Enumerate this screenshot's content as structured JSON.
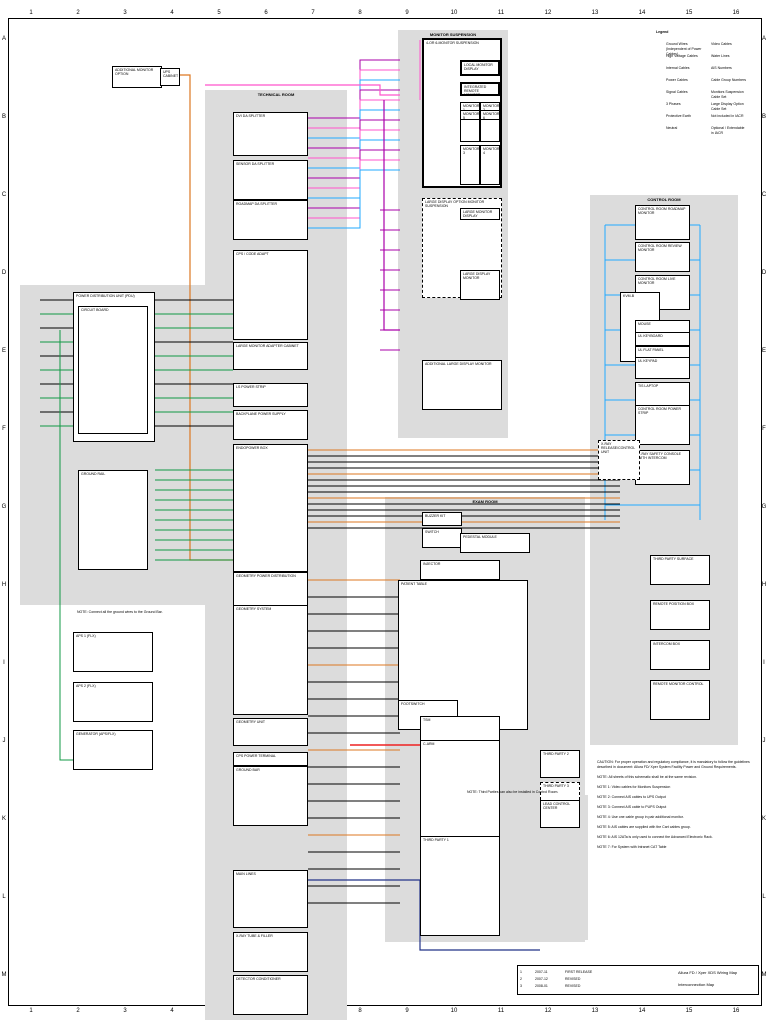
{
  "columns": [
    "1",
    "2",
    "3",
    "4",
    "5",
    "6",
    "7",
    "8",
    "9",
    "10",
    "11",
    "12",
    "13",
    "14",
    "15",
    "16"
  ],
  "rows": [
    "A",
    "B",
    "C",
    "D",
    "E",
    "F",
    "G",
    "H",
    "I",
    "J",
    "K",
    "L",
    "M"
  ],
  "rooms": [
    {
      "id": "monitor-suspension",
      "title": "MONITOR SUSPENSION"
    },
    {
      "id": "technical-room",
      "title": "TECHNICAL ROOM"
    },
    {
      "id": "exam-room",
      "title": "EXAM ROOM"
    },
    {
      "id": "control-room",
      "title": "CONTROL ROOM"
    }
  ],
  "boxes": [
    {
      "label": "ADDITIONAL MONITOR OPTION"
    },
    {
      "label": "UPS CABINET"
    },
    {
      "label": "DVI DA SPLITTER"
    },
    {
      "label": "SENSOR DA SPLITTER"
    },
    {
      "label": "ROADMAP DA SPLITTER"
    },
    {
      "label": "CPS / CODE ADAPT"
    },
    {
      "label": "LARGE MONITOR ADAPTER CABINET"
    },
    {
      "label": "LS POWER STRIP"
    },
    {
      "label": "BACKPLANE POWER SUPPLY"
    },
    {
      "label": "ENDOPOWER BOX"
    },
    {
      "label": "POWER DISTRIBUTION UNIT (PDU)"
    },
    {
      "label": "CIRCUIT BOARD"
    },
    {
      "label": "GROUND RAIL"
    },
    {
      "label": "APS 1 (FLX)"
    },
    {
      "label": "APS 2 (FLX)"
    },
    {
      "label": "GENERATOR (APS/FLX)"
    },
    {
      "label": "GEOMETRY POWER DISTRIBUTION"
    },
    {
      "label": "GEOMETRY SYSTEM"
    },
    {
      "label": "GEOMETRY UNIT"
    },
    {
      "label": "CPS POWER TERMINAL"
    },
    {
      "label": "GROUND BAR"
    },
    {
      "label": "MAIN LINES"
    },
    {
      "label": "X-RAY TUBE & FILLER"
    },
    {
      "label": "DETECTOR CONDITIONER"
    },
    {
      "label": "4-OR 6-MONITOR SUSPENSION"
    },
    {
      "label": "LOCAL MONITOR DISPLAY"
    },
    {
      "label": "INTEGRATED REMOTE MONITOR"
    },
    {
      "label": "MONITOR 1"
    },
    {
      "label": "MONITOR 2"
    },
    {
      "label": "MONITOR 3"
    },
    {
      "label": "MONITOR 4"
    },
    {
      "label": "MONITOR 5"
    },
    {
      "label": "MONITOR 6"
    },
    {
      "label": "LARGE DISPLAY OPTION MONITOR SUSPENSION"
    },
    {
      "label": "LARGE MONITOR DISPLAY"
    },
    {
      "label": "LARGE DISPLAY MONITOR"
    },
    {
      "label": "ADDITIONAL LARGE DISPLAY MONITOR"
    },
    {
      "label": "CONTROL ROOM ROADMAP MONITOR"
    },
    {
      "label": "CONTROL ROOM REVIEW MONITOR"
    },
    {
      "label": "CONTROL ROOM LIVE MONITOR"
    },
    {
      "label": "KVM-B"
    },
    {
      "label": "MOUSE"
    },
    {
      "label": "UL KEYBOARD"
    },
    {
      "label": "UL FLAT PANEL"
    },
    {
      "label": "UL KEYPAD"
    },
    {
      "label": "TIS LAPTOP"
    },
    {
      "label": "CONTROL ROOM POWER STRIP"
    },
    {
      "label": "X-RAY SAFETY CONSOLE WITH INTERCOM"
    },
    {
      "label": "X-RAY RELEASE/CONTROL UNIT"
    },
    {
      "label": "THIRD PARTY SURFACE"
    },
    {
      "label": "REMOTE POSITION BOX"
    },
    {
      "label": "INTERCOM BOX"
    },
    {
      "label": "REMOTE MONITOR CONTROL"
    },
    {
      "label": "BUZZER KIT"
    },
    {
      "label": "SWITCH"
    },
    {
      "label": "PEDESTAL MODULE"
    },
    {
      "label": "INJECTOR"
    },
    {
      "label": "PATIENT TABLE"
    },
    {
      "label": "FOOTSWITCH"
    },
    {
      "label": "TSM"
    },
    {
      "label": "C-ARM"
    },
    {
      "label": "THIRD PARTY 1"
    },
    {
      "label": "THIRD PARTY 2"
    },
    {
      "label": "THIRD PARTY 3"
    },
    {
      "label": "LEAD CONTROL CENTER"
    }
  ],
  "legend": {
    "title": "Legend",
    "items": [
      "Ground Wires (Independent of Power Cables)",
      "High Voltage Cables",
      "Internal Cables",
      "Power Cables",
      "Signal Cables",
      "3 Phases",
      "Protective Earth",
      "Neutral",
      "Video Cables",
      "Water Lines",
      "AIS Numbers",
      "Cable Group Numbers",
      "Monitors Suspension Cable Set",
      "Large Display Option Cable Set",
      "Not included in IACR",
      "Optional / Extendable in IACR"
    ]
  },
  "notes": [
    "CAUTION: For proper operation and regulatory compliance, it is mandatory to follow the guidelines described in document: Allura FD/ Xper System Facility Power and Ground Requirements.",
    "NOTE: All sheets of this schematic shall be at the same revision.",
    "NOTE 1: Video cables for Monitors Suspension",
    "NOTE 2: Connect AIS cables to UPS Output",
    "NOTE 3: Connect AIS cable to PUPS Output",
    "NOTE 4: Use one cable group in pair additional monitor.",
    "NOTE 5: AIS cables are supplied with the Cart cables group.",
    "NOTE 6: AIS 12ATa is only used to connect the Advanced Electronic Rack.",
    "NOTE 7: For System with Intranet CAT Table",
    "NOTE: Third Parties can also be installed in Control Room.",
    "NOTE: Connect all the ground wires to the Ground Bar."
  ],
  "title_block": {
    "title": "Allura FD / Xper XDS Wiring Map",
    "doc": "Interconnection Map",
    "revisions": [
      {
        "rev": "1",
        "date": "2007-11",
        "desc": "FIRST RELEASE"
      },
      {
        "rev": "2",
        "date": "2007-12",
        "desc": "REVISED"
      },
      {
        "rev": "3",
        "date": "2008-01",
        "desc": "REVISED"
      }
    ]
  },
  "colors": {
    "gray": "#dcdcdc",
    "pink": "#ff55cc",
    "purple": "#aa00aa",
    "cyan": "#22aaff",
    "orange": "#dd7722",
    "green": "#119944",
    "red": "#ee2222",
    "navy": "#223388"
  }
}
